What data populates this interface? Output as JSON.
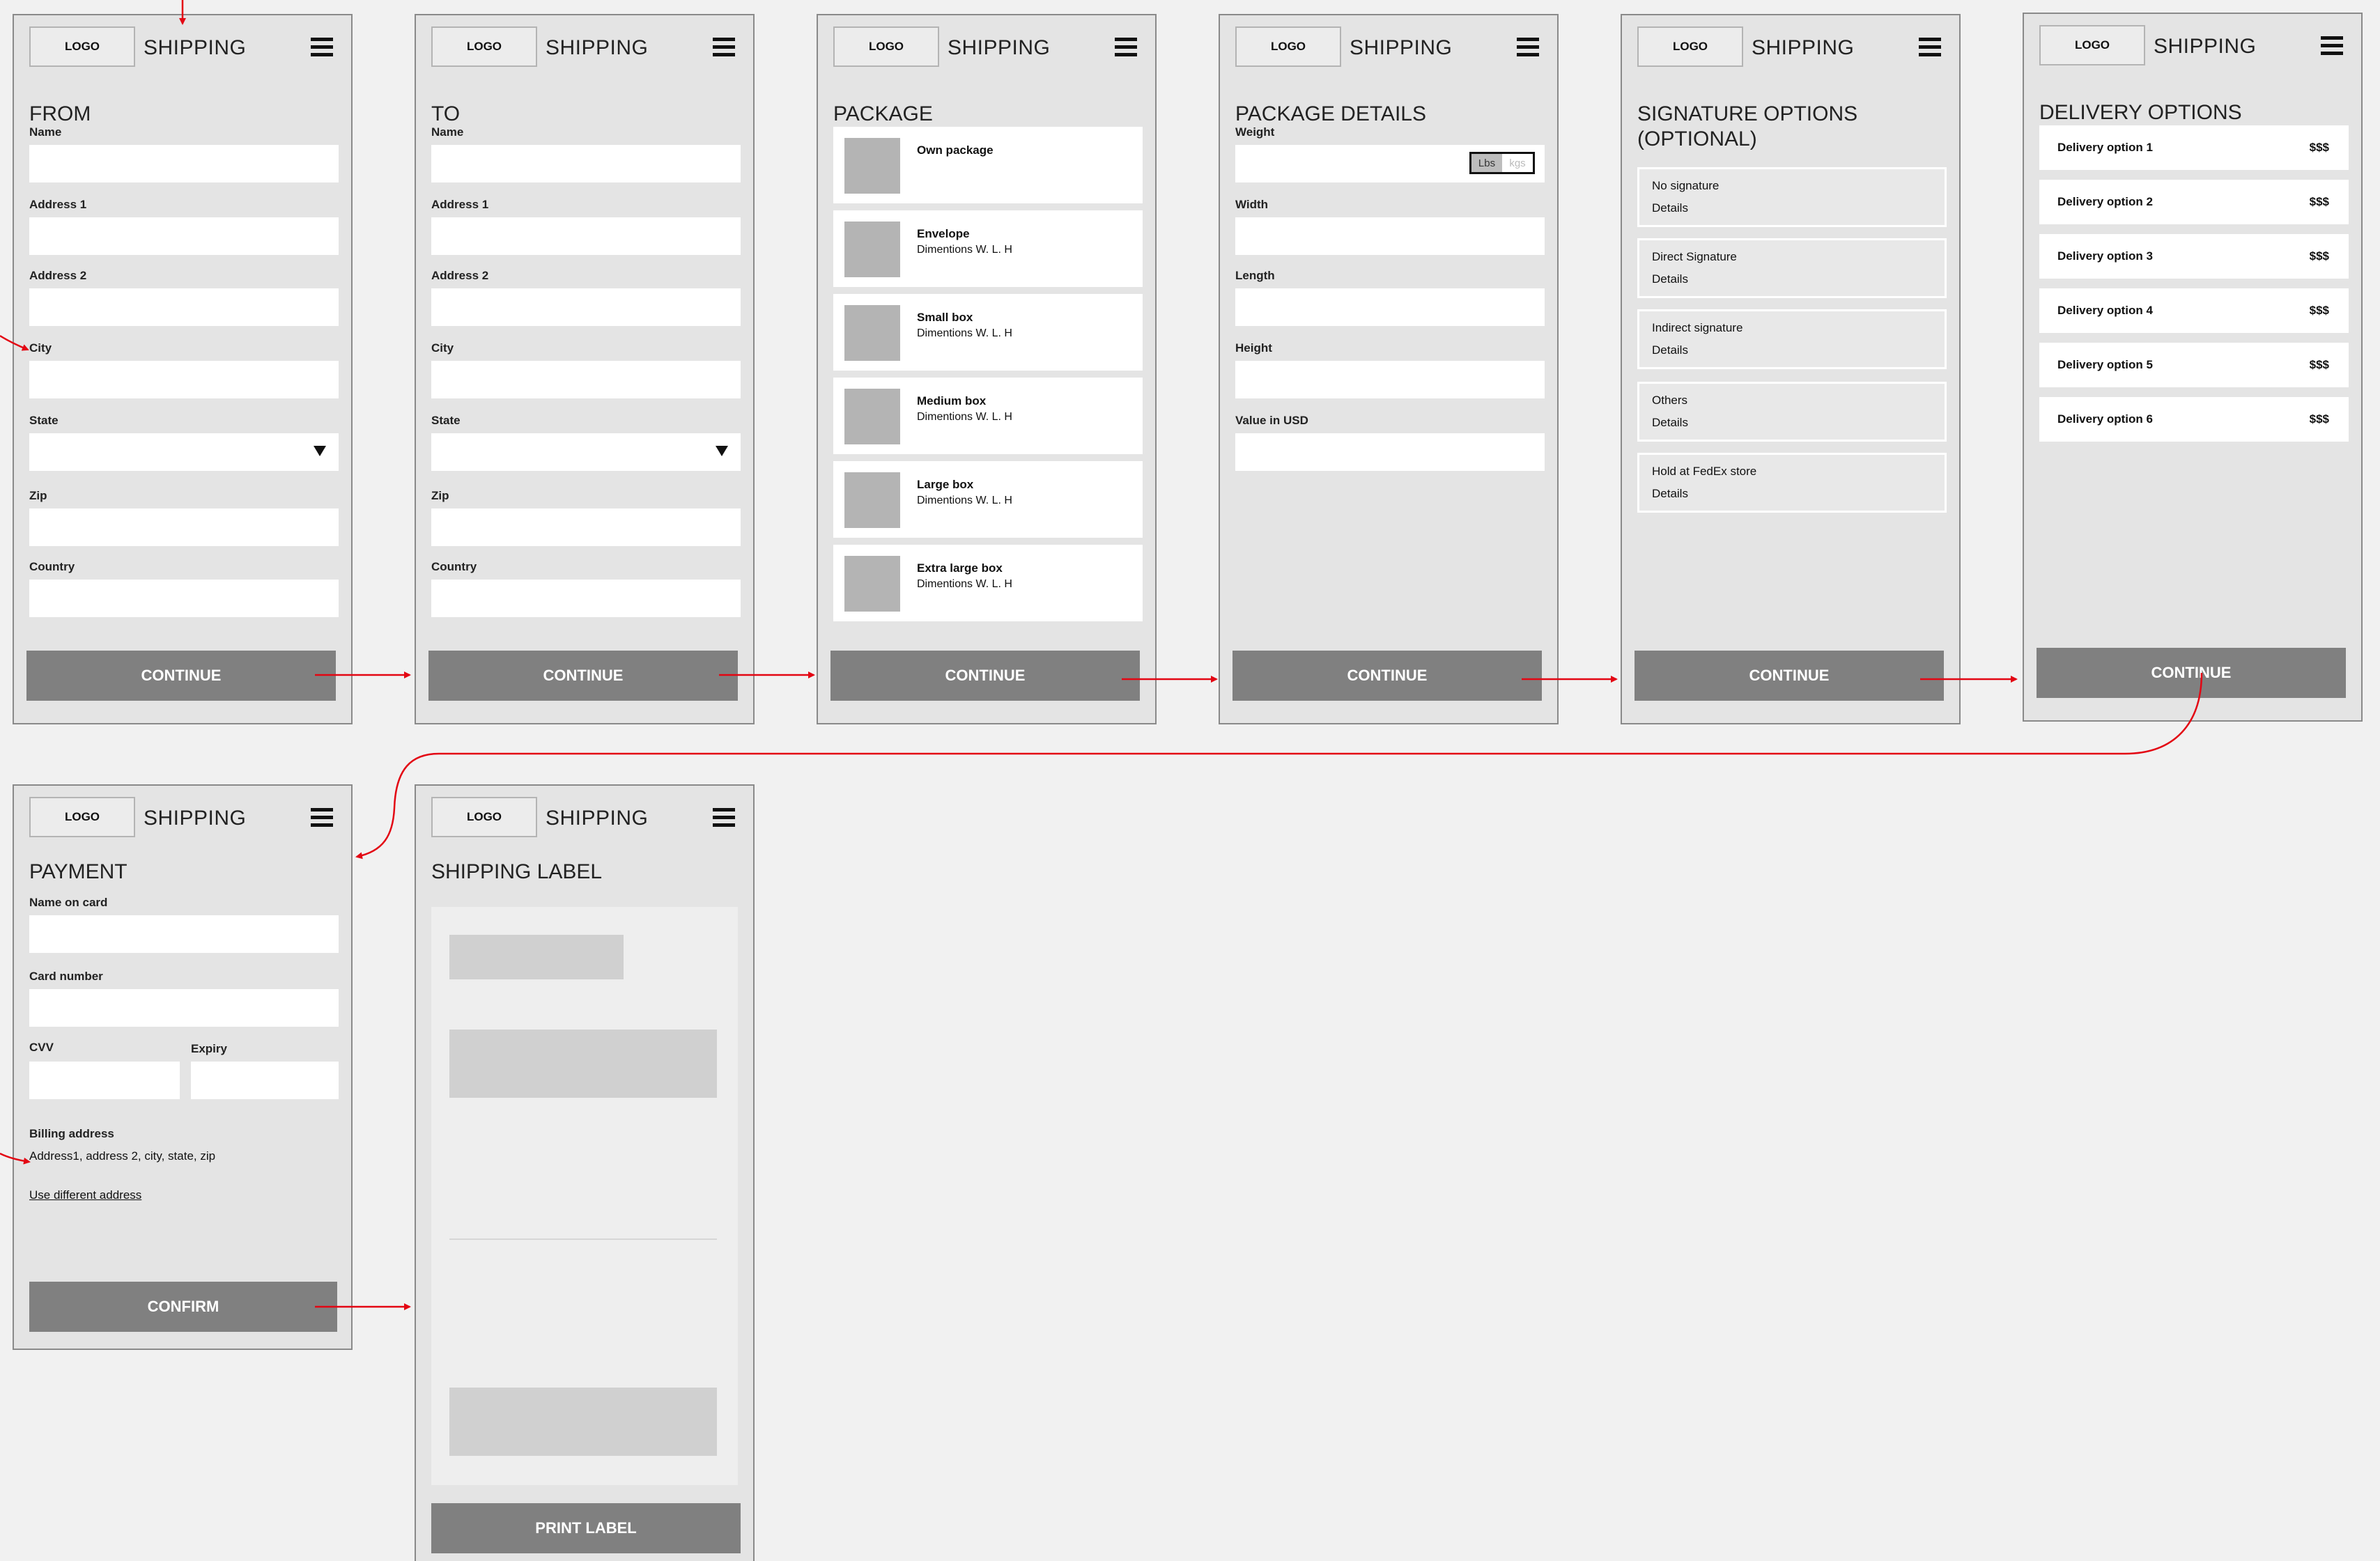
{
  "header": {
    "logo": "LOGO",
    "title": "SHIPPING"
  },
  "from": {
    "title": "FROM",
    "labels": [
      "Name",
      "Address 1",
      "Address 2",
      "City",
      "State",
      "Zip",
      "Country"
    ],
    "button": "CONTINUE"
  },
  "to": {
    "title": "TO",
    "labels": [
      "Name",
      "Address 1",
      "Address 2",
      "City",
      "State",
      "Zip",
      "Country"
    ],
    "button": "CONTINUE"
  },
  "package": {
    "title": "PACKAGE",
    "items": [
      {
        "name": "Own package",
        "dims": ""
      },
      {
        "name": "Envelope",
        "dims": "Dimentions W. L. H"
      },
      {
        "name": "Small box",
        "dims": "Dimentions W. L. H"
      },
      {
        "name": "Medium box",
        "dims": "Dimentions W. L. H"
      },
      {
        "name": "Large box",
        "dims": "Dimentions W. L. H"
      },
      {
        "name": "Extra large box",
        "dims": "Dimentions W. L. H"
      }
    ],
    "button": "CONTINUE"
  },
  "details": {
    "title": "PACKAGE DETAILS",
    "labels": [
      "Weight",
      "Width",
      "Length",
      "Height",
      "Value in USD"
    ],
    "unit_a": "Lbs",
    "unit_b": "kgs",
    "button": "CONTINUE"
  },
  "signature": {
    "title": "SIGNATURE OPTIONS (OPTIONAL)",
    "options": [
      {
        "name": "No signature",
        "details": "Details"
      },
      {
        "name": "Direct Signature",
        "details": "Details"
      },
      {
        "name": "Indirect signature",
        "details": "Details"
      },
      {
        "name": "Others",
        "details": "Details"
      },
      {
        "name": "Hold at FedEx store",
        "details": "Details"
      }
    ],
    "button": "CONTINUE"
  },
  "delivery": {
    "title": "DELIVERY OPTIONS",
    "options": [
      {
        "name": "Delivery option 1",
        "price": "$$$"
      },
      {
        "name": "Delivery option 2",
        "price": "$$$"
      },
      {
        "name": "Delivery option 3",
        "price": "$$$"
      },
      {
        "name": "Delivery option 4",
        "price": "$$$"
      },
      {
        "name": "Delivery option 5",
        "price": "$$$"
      },
      {
        "name": "Delivery option 6",
        "price": "$$$"
      }
    ],
    "button": "CONTINUE"
  },
  "payment": {
    "title": "PAYMENT",
    "name_label": "Name on card",
    "card_label": "Card number",
    "cvv_label": "CVV",
    "expiry_label": "Expiry",
    "billing_label": "Billing address",
    "billing_value": "Address1, address 2, city, state, zip",
    "link": "Use different address",
    "button": "CONFIRM"
  },
  "label": {
    "title": "SHIPPING LABEL",
    "button": "PRINT LABEL"
  },
  "colors": {
    "arrow": "#e30613",
    "button": "#808080",
    "frame": "#e4e4e4",
    "canvas": "#f1f1f1"
  }
}
